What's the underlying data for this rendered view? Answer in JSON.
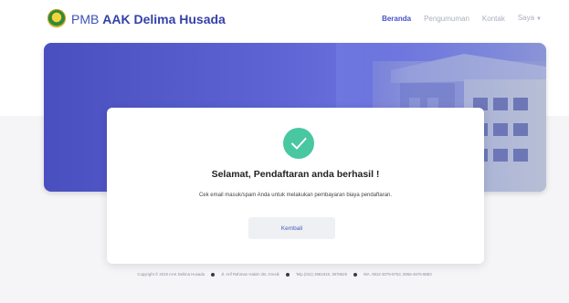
{
  "brand": {
    "prefix": "PMB",
    "name": "AAK Delima Husada"
  },
  "nav": {
    "items": [
      {
        "label": "Beranda",
        "active": true
      },
      {
        "label": "Pengumuman",
        "active": false
      },
      {
        "label": "Kontak",
        "active": false
      },
      {
        "label": "Saya",
        "active": false,
        "dropdown": true
      }
    ]
  },
  "dialog": {
    "icon": "check-circle-icon",
    "title": "Selamat, Pendaftaran anda berhasil !",
    "message": "Cek email masuk/spam Anda untuk melakukan pembayaran biaya pendaftaran.",
    "button_label": "Kembali"
  },
  "footer": {
    "copyright": "Copyright © 2019 AAK Delima Husada",
    "address": "Jl. Arif Rahman Hakim 2B, Gresik",
    "phone": "Telp.(031) 3981918, 3978628",
    "wa": "WA. 0812-3079-8753, 0856-4976-9883"
  },
  "colors": {
    "accent": "#3f51b5",
    "success": "#48c7a0",
    "hero_gradient_start": "#4a4fbf",
    "hero_gradient_end": "#8a95d6"
  }
}
